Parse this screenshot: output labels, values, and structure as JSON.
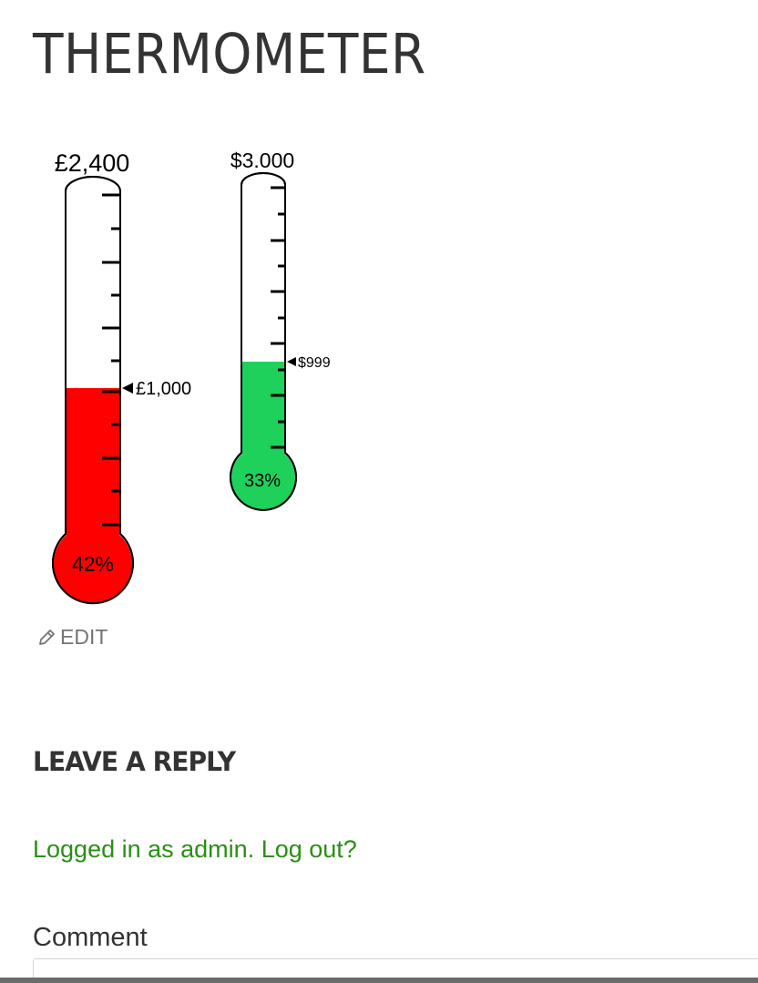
{
  "page": {
    "title": "THERMOMETER"
  },
  "thermometers": [
    {
      "target_label": "£2,400",
      "raised_label": "£1,000",
      "percent_label": "42%",
      "fraction_filled": 0.42,
      "fill_color": "#ff0000"
    },
    {
      "target_label": "$3.000",
      "raised_label": "$999",
      "percent_label": "33%",
      "fraction_filled": 0.33,
      "fill_color": "#1ed15a"
    }
  ],
  "edit": {
    "label": "EDIT",
    "icon": "pencil-icon"
  },
  "reply": {
    "heading": "LEAVE A REPLY",
    "logged_in_prefix": "Logged in as admin.",
    "logout_link": "Log out?",
    "text_color": "#2a8f15"
  },
  "comment": {
    "label": "Comment",
    "value": ""
  }
}
